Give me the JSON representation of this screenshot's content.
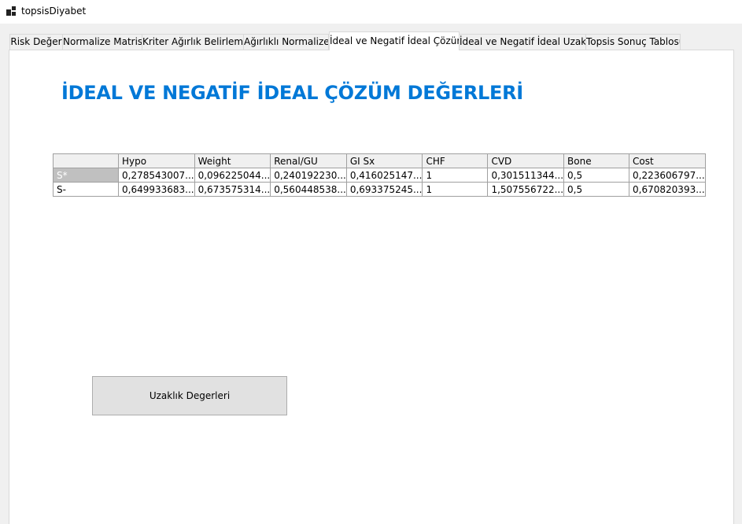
{
  "window": {
    "title": "topsisDiyabet"
  },
  "tabs": [
    {
      "label": "Risk Değer"
    },
    {
      "label": "Normalize Matris"
    },
    {
      "label": "Kriter Ağırlık Belirleme"
    },
    {
      "label": "Ağırlıklı Normalize"
    },
    {
      "label": "İdeal ve Negatif İdeal Çözüm",
      "active": true
    },
    {
      "label": "İdeal ve Negatif İdeal Uzaklık"
    },
    {
      "label": "Topsis Sonuç Tablosu"
    }
  ],
  "panel": {
    "heading": "İDEAL VE NEGATİF İDEAL ÇÖZÜM DEĞERLERİ",
    "button_label": "Uzaklık Degerleri"
  },
  "grid": {
    "columns": [
      "",
      "Hypo",
      "Weight",
      "Renal/GU",
      "GI Sx",
      "CHF",
      "CVD",
      "Bone",
      "Cost"
    ],
    "rows": [
      {
        "header": "S*",
        "selected": true,
        "cells": [
          "0,278543007...",
          "0,096225044...",
          "0,240192230...",
          "0,416025147...",
          "1",
          "0,301511344...",
          "0,5",
          "0,223606797..."
        ]
      },
      {
        "header": "S-",
        "selected": false,
        "cells": [
          "0,649933683...",
          "0,673575314...",
          "0,560448538...",
          "0,693375245...",
          "1",
          "1,507556722...",
          "0,5",
          "0,670820393..."
        ]
      }
    ]
  }
}
